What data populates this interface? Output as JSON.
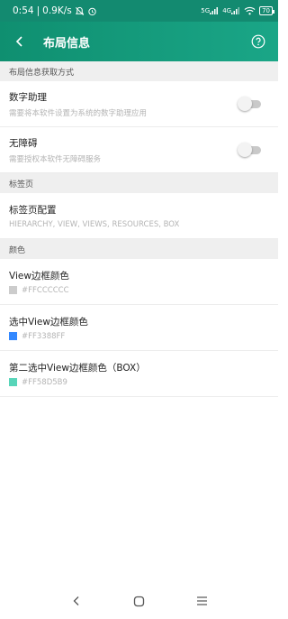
{
  "status": {
    "time": "0:54",
    "speed": "0.9K/s",
    "signal1": "5G",
    "signal2": "4G",
    "battery": "70",
    "icons": [
      "mute-icon",
      "alarm-icon",
      "signal-icon",
      "wifi-icon",
      "battery-icon"
    ]
  },
  "toolbar": {
    "title": "布局信息",
    "back_icon": "back-arrow-icon",
    "help_icon": "help-circle-icon",
    "bg_color": "#139071"
  },
  "sections": {
    "acquire": {
      "header": "布局信息获取方式",
      "items": [
        {
          "title": "数字助理",
          "subtitle": "需要将本软件设置为系统的数字助理应用",
          "enabled": false
        },
        {
          "title": "无障碍",
          "subtitle": "需要授权本软件无障碍服务",
          "enabled": false
        }
      ]
    },
    "tabs": {
      "header": "标签页",
      "items": [
        {
          "title": "标签页配置",
          "subtitle": "HIERARCHY, VIEW, VIEWS, RESOURCES, BOX"
        }
      ]
    },
    "colors": {
      "header": "颜色",
      "items": [
        {
          "title": "View边框颜色",
          "value": "#FFCCCCCC",
          "swatch": "#cccccc"
        },
        {
          "title": "选中View边框颜色",
          "value": "#FF3388FF",
          "swatch": "#3388ff"
        },
        {
          "title": "第二选中View边框颜色（BOX）",
          "value": "#FF58D5B9",
          "swatch": "#58d5b9"
        }
      ]
    }
  },
  "navbar": {
    "icons": [
      "back-nav-icon",
      "home-nav-icon",
      "recents-nav-icon"
    ]
  }
}
